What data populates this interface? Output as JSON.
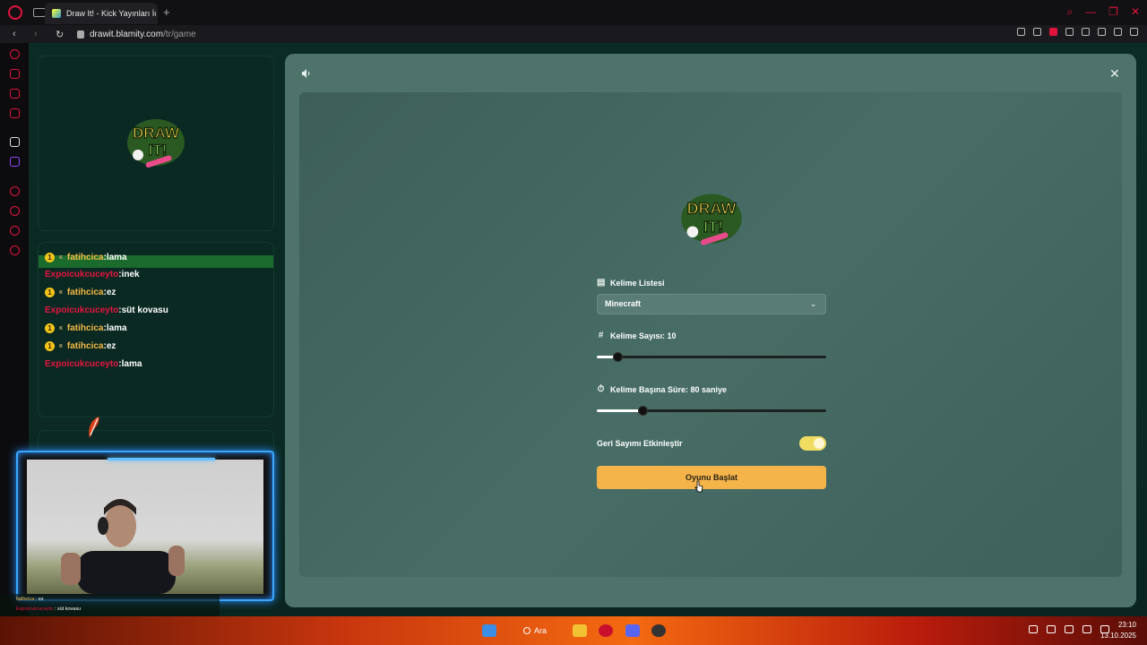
{
  "browser": {
    "tab_title": "Draw It! - Kick Yayınları İç",
    "new_tab": "+",
    "url_host": "drawit.blamity.com",
    "url_path": "/tr/game"
  },
  "chat": {
    "lines": [
      {
        "badge": "1",
        "user": "fatihcica",
        "sep": ":",
        "msg": "lama"
      },
      {
        "user": "Expoicukcuceyto",
        "sep": ":",
        "msg": "inek"
      },
      {
        "badge": "1",
        "user": "fatihcica",
        "sep": ":",
        "msg": "ez"
      },
      {
        "user": "Expoicukcuceyto",
        "sep": ":",
        "msg": "süt kovasu"
      },
      {
        "badge": "1",
        "user": "fatihcica",
        "sep": ":",
        "msg": "lama"
      },
      {
        "badge": "1",
        "user": "fatihcica",
        "sep": ":",
        "msg": "ez"
      },
      {
        "user": "Expoicukcuceyto",
        "sep": ":",
        "msg": "lama"
      }
    ]
  },
  "overlay_chat": {
    "lines": [
      {
        "user": "fatihcica",
        "msg": " : ez"
      },
      {
        "user": "Expoicukcuceyto",
        "msg": " : süt kovasu"
      },
      {
        "user": "fatihcica",
        "msg": " : lama"
      },
      {
        "user": "fatihcica",
        "msg": " : ez"
      },
      {
        "user": "Expoicukcuceyto",
        "msg": " : lama"
      }
    ]
  },
  "game": {
    "logo_text_top": "DRAW",
    "logo_text_bottom": "IT!",
    "word_list_label": "Kelime Listesi",
    "word_list_value": "Minecraft",
    "word_count_label": "Kelime Sayısı: 10",
    "word_count_fraction": 0.09,
    "time_label": "Kelime Başına Süre: 80 saniye",
    "time_fraction": 0.2,
    "countdown_label": "Geri Sayımı Etkinleştir",
    "countdown_enabled": true,
    "start_button": "Oyunu Başlat"
  },
  "taskbar": {
    "search_label": "Ara",
    "time": "23:10",
    "date": "13.10.2025"
  },
  "colors": {
    "accent_red": "#e0143c",
    "modal_bg": "#4d736b",
    "start_button": "#f5b44a",
    "toggle_on": "#f1dc62",
    "username_gold": "#f5b942",
    "username_red": "#e8133f"
  }
}
